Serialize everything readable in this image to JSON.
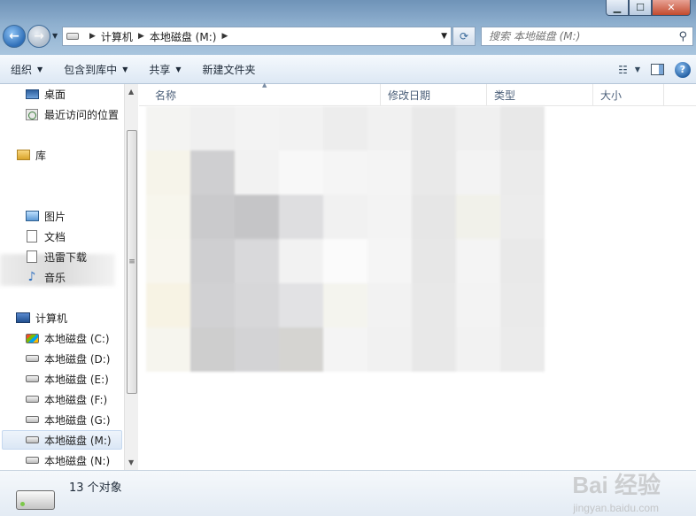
{
  "window": {
    "minimize_label": "▁",
    "maximize_label": "☐",
    "close_label": "✕"
  },
  "nav": {
    "back_icon": "back-arrow-icon",
    "forward_icon": "forward-arrow-icon"
  },
  "address": {
    "breadcrumbs": [
      "计算机",
      "本地磁盘 (M:)"
    ],
    "search_placeholder": "搜索 本地磁盘 (M:)"
  },
  "toolbar": {
    "organize": "组织",
    "include_in_library": "包含到库中",
    "share": "共享",
    "new_folder": "新建文件夹"
  },
  "sidebar": {
    "items": [
      {
        "label": "桌面",
        "icon": "desktop-icon"
      },
      {
        "label": "最近访问的位置",
        "icon": "recent-places-icon"
      },
      {
        "label": "库",
        "icon": "library-icon"
      },
      {
        "label": "图片",
        "icon": "pictures-icon"
      },
      {
        "label": "文档",
        "icon": "documents-icon"
      },
      {
        "label": "迅雷下载",
        "icon": "thunder-download-icon"
      },
      {
        "label": "音乐",
        "icon": "music-icon"
      },
      {
        "label": "计算机",
        "icon": "computer-icon"
      },
      {
        "label": "本地磁盘 (C:)",
        "icon": "drive-c-icon"
      },
      {
        "label": "本地磁盘 (D:)",
        "icon": "drive-icon"
      },
      {
        "label": "本地磁盘 (E:)",
        "icon": "drive-icon"
      },
      {
        "label": "本地磁盘 (F:)",
        "icon": "drive-icon"
      },
      {
        "label": "本地磁盘 (G:)",
        "icon": "drive-icon"
      },
      {
        "label": "本地磁盘 (M:)",
        "icon": "drive-icon",
        "selected": true
      },
      {
        "label": "本地磁盘 (N:)",
        "icon": "drive-icon"
      }
    ]
  },
  "columns": {
    "name": "名称",
    "modified": "修改日期",
    "type": "类型",
    "size": "大小"
  },
  "status": {
    "count_text": "13 个对象"
  },
  "watermark": {
    "brand": "Bai 经验",
    "url": "jingyan.baidu.com"
  }
}
